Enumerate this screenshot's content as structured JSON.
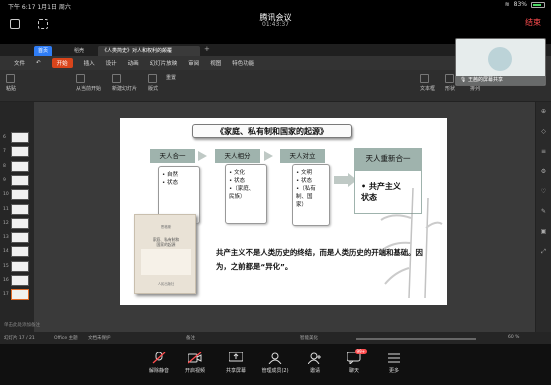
{
  "status_bar": {
    "time": "下午 6:17",
    "date": "1月1日 周六",
    "battery": "83%"
  },
  "meeting": {
    "title": "腾讯会议",
    "timer": "01:43:37",
    "end_label": "结束"
  },
  "wps": {
    "tabs": [
      {
        "label": "首页"
      },
      {
        "label": "稻壳"
      },
      {
        "label": "《人类简史》对人和权利的颠覆"
      }
    ],
    "menu": [
      "文件",
      "开始",
      "插入",
      "设计",
      "动画",
      "幻灯片放映",
      "审阅",
      "视图",
      "特色功能"
    ],
    "ribbon": {
      "paste": "粘贴",
      "from_start": "从当前开始",
      "new_slide": "新建幻灯片",
      "layout": "版式",
      "reset": "重置",
      "textbox": "文本框",
      "shape": "形状",
      "arrange": "排列"
    },
    "thumbnails": [
      {
        "n": "6"
      },
      {
        "n": "7"
      },
      {
        "n": "8"
      },
      {
        "n": "9"
      },
      {
        "n": "10"
      },
      {
        "n": "11"
      },
      {
        "n": "12"
      },
      {
        "n": "13"
      },
      {
        "n": "14"
      },
      {
        "n": "15"
      },
      {
        "n": "16"
      },
      {
        "n": "17"
      }
    ],
    "notes_placeholder": "单击此处添加备注",
    "status": {
      "slide_no": "幻灯片 17 / 21",
      "theme": "Office 主题",
      "protect": "文档未保护",
      "notes_toggle": "备注",
      "smart": "智能美化",
      "zoom": "60 %"
    }
  },
  "slide": {
    "title": "《家庭、私有制和国家的起源》",
    "stages": [
      {
        "head": "天人合一",
        "items": [
          "• 自然",
          "• 状态"
        ]
      },
      {
        "head": "天人相分",
        "items": [
          "• 文化",
          "• 状态",
          "•（家庭、",
          "  民族）"
        ]
      },
      {
        "head": "天人对立",
        "items": [
          "• 文明",
          "• 状态",
          "•（私有",
          "  制、国",
          "  家）"
        ]
      }
    ],
    "final": {
      "head": "天人重新合一",
      "items": [
        "• 共产主义",
        "  状态"
      ]
    },
    "quote": "共产主义不是人类历史的终结，而是人类历史的开端和基础。因为，之前都是“异化”。",
    "book": {
      "author": "恩格斯",
      "title": "家庭、私有制和\n国家的起源",
      "publisher": "人民出版社"
    }
  },
  "video": {
    "name": "王茜的屏幕共享"
  },
  "toolbar": [
    {
      "label": "解除静音",
      "icon": "mic-muted-icon"
    },
    {
      "label": "开启视频",
      "icon": "camera-off-icon"
    },
    {
      "label": "共享屏幕",
      "icon": "share-screen-icon"
    },
    {
      "label": "管理成员(2)",
      "icon": "members-icon"
    },
    {
      "label": "邀请",
      "icon": "invite-icon"
    },
    {
      "label": "聊天",
      "icon": "chat-icon",
      "badge": "99+"
    },
    {
      "label": "更多",
      "icon": "more-icon"
    }
  ],
  "colors": {
    "accent": "#2f7df6",
    "end_red": "#ff4d4f",
    "header_teal": "#9fb3ad"
  }
}
